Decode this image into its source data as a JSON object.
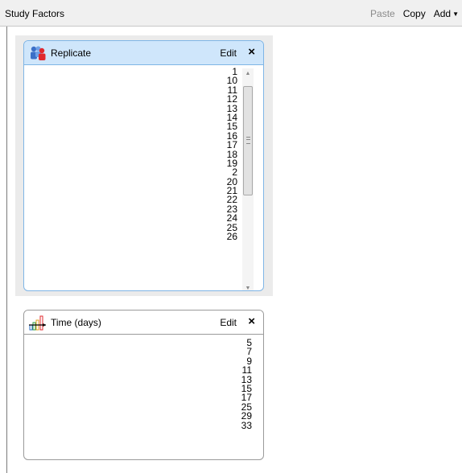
{
  "topbar": {
    "title": "Study Factors",
    "paste_label": "Paste",
    "copy_label": "Copy",
    "add_label": "Add"
  },
  "factors": [
    {
      "name": "Replicate",
      "icon": "people-icon",
      "edit_label": "Edit",
      "close_label": "×",
      "values": [
        "1",
        "10",
        "11",
        "12",
        "13",
        "14",
        "15",
        "16",
        "17",
        "18",
        "19",
        "2",
        "20",
        "21",
        "22",
        "23",
        "24",
        "25",
        "26"
      ]
    },
    {
      "name": "Time (days)",
      "icon": "chart-timeline-icon",
      "edit_label": "Edit",
      "close_label": "×",
      "values": [
        "5",
        "7",
        "9",
        "11",
        "13",
        "15",
        "17",
        "25",
        "29",
        "33"
      ]
    }
  ],
  "scrollbar": {
    "up": "▲",
    "down": "▼"
  },
  "colors": {
    "selected_header": "#cfe6fb",
    "selected_border": "#7fb5e6"
  }
}
